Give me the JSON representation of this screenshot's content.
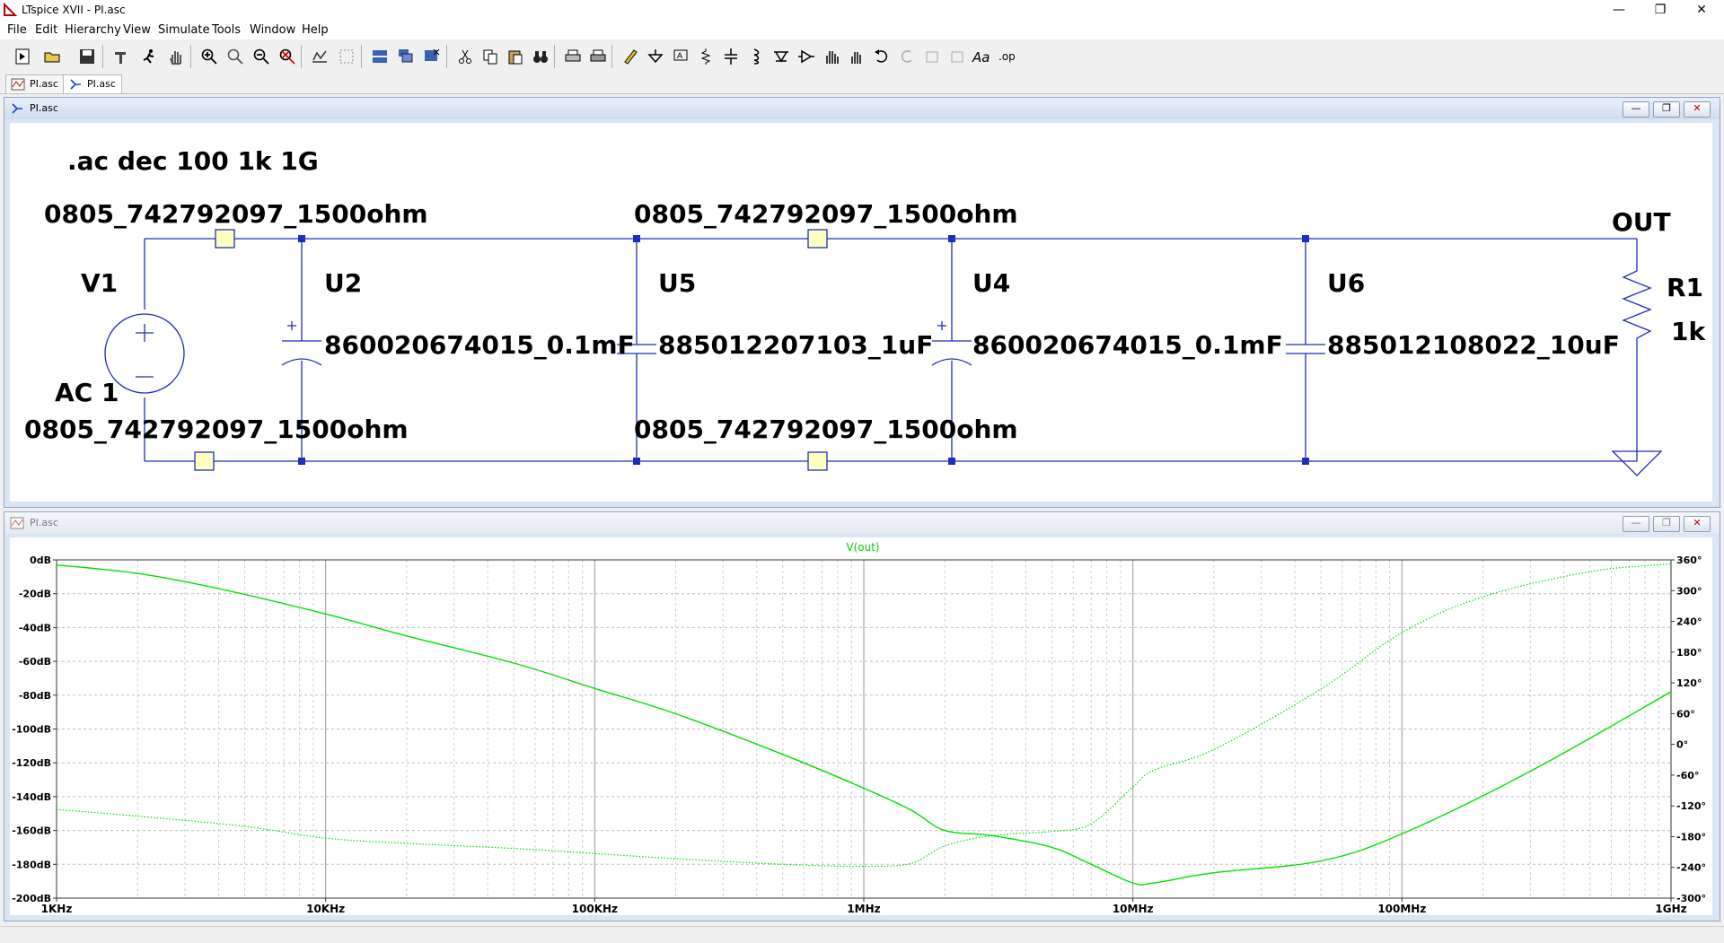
{
  "app": {
    "window_title": "LTspice XVII - PI.asc",
    "menu": [
      "File",
      "Edit",
      "Hierarchy",
      "View",
      "Simulate",
      "Tools",
      "Window",
      "Help"
    ],
    "tabs": [
      {
        "label": "PI.asc",
        "kind": "waveform"
      },
      {
        "label": "PI.asc",
        "kind": "schematic"
      }
    ]
  },
  "schematic": {
    "title": "PI.asc",
    "directive": ".ac dec 100 1k 1G",
    "labels": {
      "ferrite_top_left": "0805_742792097_1500ohm",
      "ferrite_top_mid": "0805_742792097_1500ohm",
      "ferrite_bot_left": "0805_742792097_1500ohm",
      "ferrite_bot_mid": "0805_742792097_1500ohm",
      "v1_name": "V1",
      "v1_value": "AC 1",
      "u2_name": "U2",
      "u2_value": "860020674015_0.1mF",
      "u5_name": "U5",
      "u5_value": "885012207103_1uF",
      "u4_name": "U4",
      "u4_value": "860020674015_0.1mF",
      "u6_name": "U6",
      "u6_value": "885012108022_10uF",
      "out_label": "OUT",
      "r1_name": "R1",
      "r1_value": "1k"
    }
  },
  "waveform": {
    "title": "PI.asc",
    "trace_name": "V(out)",
    "trace_color": "#00e000"
  },
  "chart_data": {
    "type": "line",
    "title": "V(out)",
    "x_scale": "log",
    "xlim_hz": [
      1000,
      1000000000
    ],
    "x_tick_labels": [
      "1KHz",
      "10KHz",
      "100KHz",
      "1MHz",
      "10MHz",
      "100MHz",
      "1GHz"
    ],
    "x_tick_values": [
      1000,
      10000,
      100000,
      1000000,
      10000000,
      100000000,
      1000000000
    ],
    "y_left_label_unit": "dB",
    "ylim_left": [
      -200,
      0
    ],
    "y_left_tick_labels": [
      "0dB",
      "-20dB",
      "-40dB",
      "-60dB",
      "-80dB",
      "-100dB",
      "-120dB",
      "-140dB",
      "-160dB",
      "-180dB",
      "-200dB"
    ],
    "y_left_tick_values": [
      0,
      -20,
      -40,
      -60,
      -80,
      -100,
      -120,
      -140,
      -160,
      -180,
      -200
    ],
    "ylim_right": [
      -300,
      360
    ],
    "y_right_tick_labels": [
      "360°",
      "300°",
      "240°",
      "180°",
      "120°",
      "60°",
      "0°",
      "-60°",
      "-120°",
      "-180°",
      "-240°",
      "-300°"
    ],
    "y_right_tick_values": [
      360,
      300,
      240,
      180,
      120,
      60,
      0,
      -60,
      -120,
      -180,
      -240,
      -300
    ],
    "grid": true,
    "series": [
      {
        "name": "V(out)",
        "style": "solid",
        "axis": "left",
        "x": [
          1000,
          2000,
          4000,
          10000,
          20000,
          50000,
          100000,
          200000,
          500000,
          1000000,
          1500000,
          2000000,
          3000000,
          5000000,
          7000000,
          10000000,
          12000000,
          20000000,
          50000000,
          100000000,
          300000000,
          1000000000
        ],
        "y": [
          -3,
          -8,
          -17,
          -32,
          -45,
          -61,
          -76,
          -91,
          -115,
          -135,
          -148,
          -160,
          -163,
          -170,
          -180,
          -191,
          -191,
          -185,
          -178,
          -162,
          -125,
          -78
        ]
      },
      {
        "name": "V(out) phase",
        "style": "dotted",
        "axis": "right",
        "x": [
          1000,
          2000,
          5000,
          10000,
          20000,
          50000,
          100000,
          200000,
          500000,
          1000000,
          1500000,
          2000000,
          3000000,
          5000000,
          7000000,
          10000000,
          12000000,
          20000000,
          50000000,
          100000000,
          200000000,
          500000000,
          1000000000
        ],
        "y": [
          -127,
          -140,
          -160,
          -183,
          -193,
          -203,
          -213,
          -223,
          -234,
          -238,
          -232,
          -198,
          -178,
          -170,
          -155,
          -83,
          -50,
          -10,
          108,
          218,
          288,
          337,
          352
        ]
      }
    ]
  }
}
